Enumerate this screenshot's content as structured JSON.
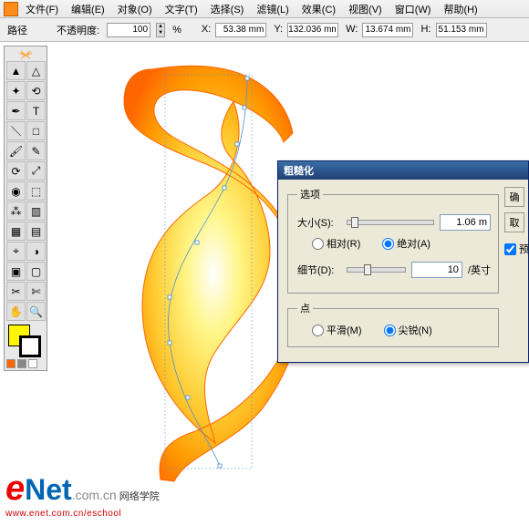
{
  "menu": {
    "items": [
      "文件(F)",
      "编辑(E)",
      "对象(O)",
      "文字(T)",
      "选择(S)",
      "滤镜(L)",
      "效果(C)",
      "视图(V)",
      "窗口(W)",
      "帮助(H)"
    ]
  },
  "control_bar": {
    "mode": "路径",
    "opacity_label": "不透明度:",
    "opacity_value": "100",
    "opacity_unit": "%",
    "x_label": "X:",
    "x_value": "53.38 mm",
    "y_label": "Y:",
    "y_value": "132.036 mm",
    "w_label": "W:",
    "w_value": "13.674 mm",
    "h_label": "H:",
    "h_value": "51.153 mm"
  },
  "tools": [
    "selection",
    "direct-selection",
    "magic-wand",
    "lasso",
    "pen",
    "type",
    "line",
    "rectangle",
    "paintbrush",
    "pencil",
    "rotate",
    "scale",
    "warp",
    "free-transform",
    "symbol-sprayer",
    "graph",
    "mesh",
    "gradient",
    "eyedropper",
    "blend",
    "live-paint",
    "live-paint-select",
    "slice",
    "scissors",
    "hand",
    "zoom"
  ],
  "colors": {
    "fill": "#fff700",
    "stroke": "#000000",
    "swatches": [
      "#ff6600",
      "#888888",
      "#ffffff"
    ]
  },
  "dialog": {
    "title": "粗糙化",
    "options_legend": "选项",
    "size_label": "大小(S):",
    "size_value": "1.06 m",
    "relative_label": "相对(R)",
    "absolute_label": "绝对(A)",
    "size_mode": "absolute",
    "detail_label": "细节(D):",
    "detail_value": "10",
    "detail_unit": "/英寸",
    "points_legend": "点",
    "smooth_label": "平滑(M)",
    "corner_label": "尖锐(N)",
    "points_mode": "corner",
    "ok": "确",
    "cancel": "取",
    "preview": "预"
  },
  "watermark": {
    "brand_e": "e",
    "brand_net": "Net",
    "brand_com": ".com.cn",
    "zh": "网络学院",
    "url": "www.enet.com.cn/eschool"
  }
}
